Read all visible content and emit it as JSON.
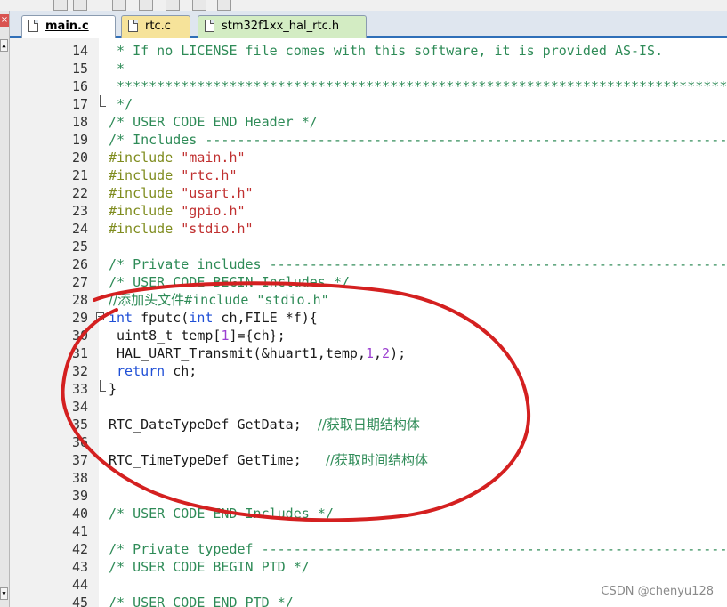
{
  "tabs": [
    {
      "label": "main.c",
      "active": true
    },
    {
      "label": "rtc.c",
      "active": false
    },
    {
      "label": "stm32f1xx_hal_rtc.h",
      "active": false
    }
  ],
  "colors": {
    "comment": "#2e8b57",
    "preprocessor": "#7f8c1e",
    "string": "#c03030",
    "keyword": "#1f4fd6",
    "number": "#9b3fd0",
    "annotation": "#d42020"
  },
  "lines": [
    {
      "n": "14",
      "segs": [
        {
          "t": " * If no LICENSE file comes with this software, it is provided AS-IS.",
          "c": "com"
        }
      ]
    },
    {
      "n": "15",
      "segs": [
        {
          "t": " *",
          "c": "com"
        }
      ]
    },
    {
      "n": "16",
      "segs": [
        {
          "t": " ******************************************************************************",
          "c": "com"
        }
      ]
    },
    {
      "n": "17",
      "fold_end": true,
      "segs": [
        {
          "t": " */",
          "c": "com"
        }
      ]
    },
    {
      "n": "18",
      "segs": [
        {
          "t": "/* USER CODE END Header */",
          "c": "com"
        }
      ]
    },
    {
      "n": "19",
      "segs": [
        {
          "t": "/* Includes ------------------------------------------------------------------",
          "c": "com"
        }
      ]
    },
    {
      "n": "20",
      "segs": [
        {
          "t": "#include ",
          "c": "pre"
        },
        {
          "t": "\"main.h\"",
          "c": "str"
        }
      ]
    },
    {
      "n": "21",
      "segs": [
        {
          "t": "#include ",
          "c": "pre"
        },
        {
          "t": "\"rtc.h\"",
          "c": "str"
        }
      ]
    },
    {
      "n": "22",
      "segs": [
        {
          "t": "#include ",
          "c": "pre"
        },
        {
          "t": "\"usart.h\"",
          "c": "str"
        }
      ]
    },
    {
      "n": "23",
      "segs": [
        {
          "t": "#include ",
          "c": "pre"
        },
        {
          "t": "\"gpio.h\"",
          "c": "str"
        }
      ]
    },
    {
      "n": "24",
      "segs": [
        {
          "t": "#include ",
          "c": "pre"
        },
        {
          "t": "\"stdio.h\"",
          "c": "str"
        }
      ]
    },
    {
      "n": "25",
      "segs": []
    },
    {
      "n": "26",
      "segs": [
        {
          "t": "/* Private includes ----------------------------------------------------------",
          "c": "com"
        }
      ]
    },
    {
      "n": "27",
      "segs": [
        {
          "t": "/* USER CODE BEGIN Includes */",
          "c": "com"
        }
      ]
    },
    {
      "n": "28",
      "segs": [
        {
          "t": "//添加头文件",
          "c": "com",
          "cjk": true
        },
        {
          "t": "#include \"stdio.h\"",
          "c": "com"
        }
      ]
    },
    {
      "n": "29",
      "fold_start": true,
      "segs": [
        {
          "t": "int",
          "c": "kw"
        },
        {
          "t": " fputc(",
          "c": "pl"
        },
        {
          "t": "int",
          "c": "kw"
        },
        {
          "t": " ch,FILE *f){",
          "c": "pl"
        }
      ]
    },
    {
      "n": "30",
      "segs": [
        {
          "t": " uint8_t temp[",
          "c": "pl"
        },
        {
          "t": "1",
          "c": "num"
        },
        {
          "t": "]={ch};",
          "c": "pl"
        }
      ]
    },
    {
      "n": "31",
      "segs": [
        {
          "t": " HAL_UART_Transmit(&huart1,temp,",
          "c": "pl"
        },
        {
          "t": "1",
          "c": "num"
        },
        {
          "t": ",",
          "c": "pl"
        },
        {
          "t": "2",
          "c": "num"
        },
        {
          "t": ");",
          "c": "pl"
        }
      ]
    },
    {
      "n": "32",
      "segs": [
        {
          "t": " ",
          "c": "pl"
        },
        {
          "t": "return",
          "c": "kw"
        },
        {
          "t": " ch;",
          "c": "pl"
        }
      ]
    },
    {
      "n": "33",
      "fold_end": true,
      "segs": [
        {
          "t": "}",
          "c": "pl"
        }
      ]
    },
    {
      "n": "34",
      "segs": []
    },
    {
      "n": "35",
      "segs": [
        {
          "t": "RTC_DateTypeDef GetData;  ",
          "c": "pl"
        },
        {
          "t": "//获取日期结构体",
          "c": "com",
          "cjk": true
        }
      ]
    },
    {
      "n": "36",
      "segs": []
    },
    {
      "n": "37",
      "segs": [
        {
          "t": "RTC_TimeTypeDef GetTime;   ",
          "c": "pl"
        },
        {
          "t": "//获取时间结构体",
          "c": "com",
          "cjk": true
        }
      ]
    },
    {
      "n": "38",
      "segs": []
    },
    {
      "n": "39",
      "segs": []
    },
    {
      "n": "40",
      "segs": [
        {
          "t": "/* USER CODE END Includes */",
          "c": "com"
        }
      ]
    },
    {
      "n": "41",
      "segs": []
    },
    {
      "n": "42",
      "segs": [
        {
          "t": "/* Private typedef -----------------------------------------------------------",
          "c": "com"
        }
      ]
    },
    {
      "n": "43",
      "segs": [
        {
          "t": "/* USER CODE BEGIN PTD */",
          "c": "com"
        }
      ]
    },
    {
      "n": "44",
      "segs": []
    },
    {
      "n": "45",
      "segs": [
        {
          "t": "/* USER CODE END PTD */",
          "c": "com"
        }
      ]
    }
  ],
  "watermark": "CSDN @chenyu128"
}
